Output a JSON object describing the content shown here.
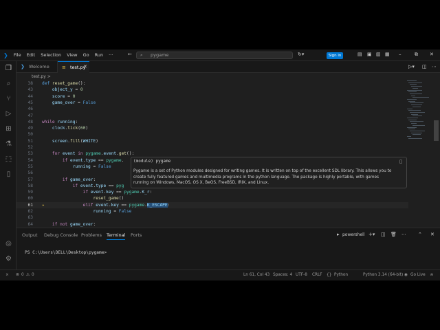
{
  "colors": {
    "accent": "#0078d4",
    "editor_bg": "#1f1f1f",
    "chrome_bg": "#181818"
  },
  "titlebar": {
    "menu": [
      "File",
      "Edit",
      "Selection",
      "View",
      "Go",
      "Run",
      "···"
    ],
    "search_text": "pygame",
    "signin": "Sign in"
  },
  "tabs": [
    {
      "label": "Welcome",
      "icon": "vscode-icon"
    },
    {
      "label": "test.py",
      "icon": "python-file-icon"
    }
  ],
  "breadcrumb": "test.py  >",
  "editor": {
    "current_line": "61",
    "lines": [
      {
        "n": "38",
        "html": "<span class=\"def\">def</span> <span class=\"fn\">reset_game</span>():"
      },
      {
        "n": "43",
        "html": "    <span class=\"var\">object_y</span> = <span class=\"num\">0</span>"
      },
      {
        "n": "44",
        "html": "    <span class=\"var\">score</span> = <span class=\"num\">0</span>"
      },
      {
        "n": "45",
        "html": "    <span class=\"var\">game_over</span> = <span class=\"def\">False</span>"
      },
      {
        "n": "46",
        "html": ""
      },
      {
        "n": "47",
        "html": ""
      },
      {
        "n": "48",
        "html": "<span class=\"kw\">while</span> <span class=\"var\">running</span>:"
      },
      {
        "n": "49",
        "html": "    <span class=\"var\">clock</span>.<span class=\"fn\">tick</span>(<span class=\"num\">60</span>)"
      },
      {
        "n": "50",
        "html": ""
      },
      {
        "n": "51",
        "html": "    <span class=\"var\">screen</span>.<span class=\"fn\">fill</span>(<span class=\"var\">WHITE</span>)"
      },
      {
        "n": "52",
        "html": ""
      },
      {
        "n": "53",
        "html": "    <span class=\"kw\">for</span> <span class=\"var\">event</span> <span class=\"kw\">in</span> <span class=\"cls\">pygame</span>.<span class=\"var\">event</span>.<span class=\"fn\">get</span>():"
      },
      {
        "n": "54",
        "html": "        <span class=\"kw\">if</span> <span class=\"var\">event</span>.<span class=\"var\">type</span> == <span class=\"cls\">pygame</span>."
      },
      {
        "n": "55",
        "html": "            <span class=\"var\">running</span> = <span class=\"def\">False</span>"
      },
      {
        "n": "56",
        "html": ""
      },
      {
        "n": "57",
        "html": "        <span class=\"kw\">if</span> <span class=\"var\">game_over</span>:"
      },
      {
        "n": "58",
        "html": "            <span class=\"kw\">if</span> <span class=\"var\">event</span>.<span class=\"var\">type</span> == <span class=\"cls\">pyg</span>"
      },
      {
        "n": "59",
        "html": "                <span class=\"kw\">if</span> <span class=\"var\">event</span>.<span class=\"var\">key</span> == <span class=\"cls\">pygame</span>.<span class=\"var\">K_r</span>:"
      },
      {
        "n": "60",
        "html": "                    <span class=\"fn\">reset_game</span>()"
      },
      {
        "n": "61",
        "html": "                <span class=\"kw\">elif</span> <span class=\"var\">event</span>.<span class=\"var\">key</span> == <span class=\"cls\">pygame</span>.<span class=\"var hl\">K_ESCAPE</span>:"
      },
      {
        "n": "62",
        "html": "                    <span class=\"var\">running</span> = <span class=\"def\">False</span>"
      },
      {
        "n": "63",
        "html": ""
      },
      {
        "n": "64",
        "html": "    <span class=\"kw\">if</span> <span class=\"kw\">not</span> <span class=\"var\">game_over</span>:"
      }
    ]
  },
  "hover": {
    "title": "(module) pygame",
    "body": "Pygame is a set of Python modules designed for writing games. It is written on top of the excellent SDL library. This allows you to create fully featured games and multimedia programs in the python language. The package is highly portable, with games running on Windows, MacOS, OS X, BeOS, FreeBSD, IRIX, and Linux."
  },
  "panel": {
    "tabs": [
      "Output",
      "Debug Console",
      "Problems",
      "Terminal",
      "Ports"
    ],
    "shell": "powershell",
    "prompt": "PS C:\\Users\\DELL\\Desktop\\pygame>"
  },
  "statusbar": {
    "errors": "0",
    "warnings": "0",
    "position": "Ln 61, Col 43",
    "indent": "Spaces: 4",
    "encoding": "UTF-8",
    "eol": "CRLF",
    "language": "Python",
    "interpreter": "Python 3.14 (64-bit)",
    "live": "Go Live"
  }
}
